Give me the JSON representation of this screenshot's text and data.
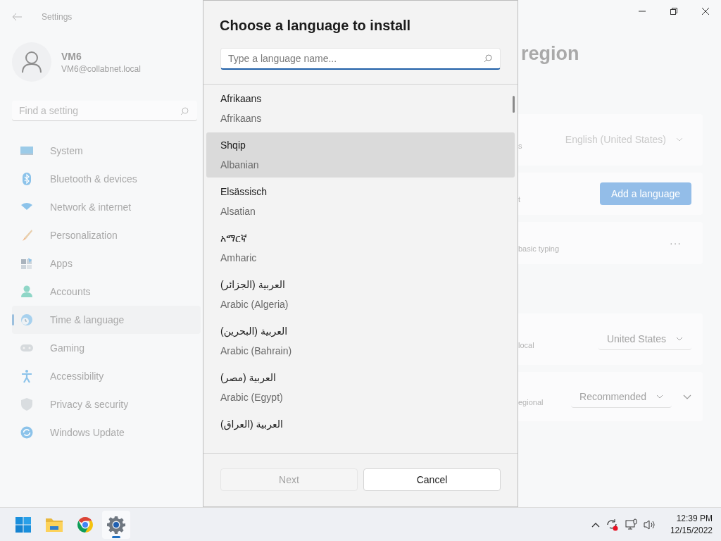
{
  "window": {
    "title": "Settings"
  },
  "account": {
    "name": "VM6",
    "email": "VM6@collabnet.local"
  },
  "search": {
    "placeholder": "Find a setting"
  },
  "nav": [
    {
      "label": "System",
      "selected": false
    },
    {
      "label": "Bluetooth & devices",
      "selected": false
    },
    {
      "label": "Network & internet",
      "selected": false
    },
    {
      "label": "Personalization",
      "selected": false
    },
    {
      "label": "Apps",
      "selected": false
    },
    {
      "label": "Accounts",
      "selected": false
    },
    {
      "label": "Time & language",
      "selected": true
    },
    {
      "label": "Gaming",
      "selected": false
    },
    {
      "label": "Accessibility",
      "selected": false
    },
    {
      "label": "Privacy & security",
      "selected": false
    },
    {
      "label": "Windows Update",
      "selected": false
    }
  ],
  "page": {
    "title": "region",
    "groups": [
      {
        "cards": [
          {
            "kind": "dropdown",
            "label": "s",
            "value": "English (United States)",
            "disabled": true
          },
          {
            "kind": "button",
            "label": "t",
            "button": "Add a language"
          },
          {
            "kind": "more",
            "label": "basic typing",
            "button": "···"
          }
        ]
      },
      {
        "cards": [
          {
            "kind": "dropdown",
            "label": "local",
            "value": "United States",
            "disabled": false
          },
          {
            "kind": "expander",
            "label": "egional",
            "value": "Recommended",
            "disabled": false
          }
        ]
      }
    ]
  },
  "dialog": {
    "title": "Choose a language to install",
    "search": {
      "placeholder": "Type a language name..."
    },
    "languages": [
      {
        "native": "Afrikaans",
        "english": "Afrikaans",
        "selected": false
      },
      {
        "native": "Shqip",
        "english": "Albanian",
        "selected": true
      },
      {
        "native": "Elsässisch",
        "english": "Alsatian",
        "selected": false
      },
      {
        "native": "አማርኛ",
        "english": "Amharic",
        "selected": false
      },
      {
        "native": "العربية (الجزائر)",
        "english": "Arabic (Algeria)",
        "selected": false
      },
      {
        "native": "العربية (البحرين)",
        "english": "Arabic (Bahrain)",
        "selected": false
      },
      {
        "native": "العربية (مصر)",
        "english": "Arabic (Egypt)",
        "selected": false
      },
      {
        "native": "العربية (العراق)",
        "selected": false
      }
    ],
    "buttons": [
      {
        "label": "Next",
        "disabled": true
      },
      {
        "label": "Cancel",
        "disabled": false
      }
    ]
  },
  "taskbar": {
    "apps": [
      {
        "kind": "start",
        "running": false
      },
      {
        "kind": "explorer",
        "running": false
      },
      {
        "kind": "chrome",
        "running": false
      },
      {
        "kind": "settings",
        "running": true
      }
    ],
    "clock": {
      "time": "12:39 PM",
      "date": "12/15/2022"
    }
  }
}
